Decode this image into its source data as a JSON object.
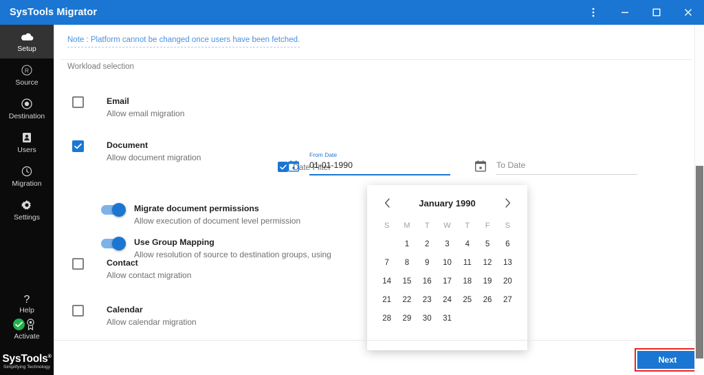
{
  "window": {
    "title": "SysTools Migrator",
    "controls": [
      {
        "name": "menu",
        "glyph": "kebab"
      },
      {
        "name": "minimize",
        "glyph": "minus"
      },
      {
        "name": "maximize",
        "glyph": "square"
      },
      {
        "name": "close",
        "glyph": "cross"
      }
    ],
    "accent_color": "#1a76d2"
  },
  "sidebar": {
    "items": [
      {
        "label": "Setup",
        "icon": "cloud-icon",
        "active": true
      },
      {
        "label": "Source",
        "icon": "source-icon",
        "active": false
      },
      {
        "label": "Destination",
        "icon": "destination-icon",
        "active": false
      },
      {
        "label": "Users",
        "icon": "users-icon",
        "active": false
      },
      {
        "label": "Migration",
        "icon": "clock-icon",
        "active": false
      },
      {
        "label": "Settings",
        "icon": "gear-icon",
        "active": false
      }
    ],
    "help": {
      "label": "Help",
      "icon": "question-icon"
    },
    "activate": {
      "label": "Activate",
      "icon": "badge-icon",
      "status_icon": "green-check-icon",
      "status_color": "#23b14d"
    },
    "brand": {
      "name": "SysTools",
      "trademark": "®",
      "tagline": "Simplifying Technology"
    }
  },
  "content": {
    "note": "Note : Platform cannot be changed once users have been fetched.",
    "section_label": "Workload selection",
    "workloads": [
      {
        "title": "Email",
        "subtitle": "Allow email migration",
        "checked": false
      },
      {
        "title": "Document",
        "subtitle": "Allow document migration",
        "checked": true
      },
      {
        "title": "Contact",
        "subtitle": "Allow contact migration",
        "checked": false
      },
      {
        "title": "Calendar",
        "subtitle": "Allow calendar migration",
        "checked": false
      }
    ],
    "toggles": [
      {
        "title": "Migrate document permissions",
        "subtitle": "Allow execution of document level permission",
        "on": true
      },
      {
        "title": "Use Group Mapping",
        "subtitle": "Allow resolution of source to destination groups, using ",
        "on": true
      }
    ],
    "date_filter": {
      "label": "Date Filter",
      "checked": true,
      "from": {
        "float_label": "From Date",
        "value": "01-01-1990",
        "placeholder": "From Date",
        "icon": "calendar-icon",
        "focused": true
      },
      "to": {
        "float_label": "",
        "value": "",
        "placeholder": "To Date",
        "icon": "calendar-icon",
        "focused": false
      }
    },
    "calendar": {
      "prev_icon": "chevron-left-icon",
      "next_icon": "chevron-right-icon",
      "title": "January 1990",
      "dow": [
        "S",
        "M",
        "T",
        "W",
        "T",
        "F",
        "S"
      ],
      "leading_blanks": 1,
      "days": [
        1,
        2,
        3,
        4,
        5,
        6,
        7,
        8,
        9,
        10,
        11,
        12,
        13,
        14,
        15,
        16,
        17,
        18,
        19,
        20,
        21,
        22,
        23,
        24,
        25,
        26,
        27,
        28,
        29,
        30,
        31
      ]
    },
    "footer": {
      "next_label": "Next",
      "highlight_color": "#ef2020"
    }
  }
}
